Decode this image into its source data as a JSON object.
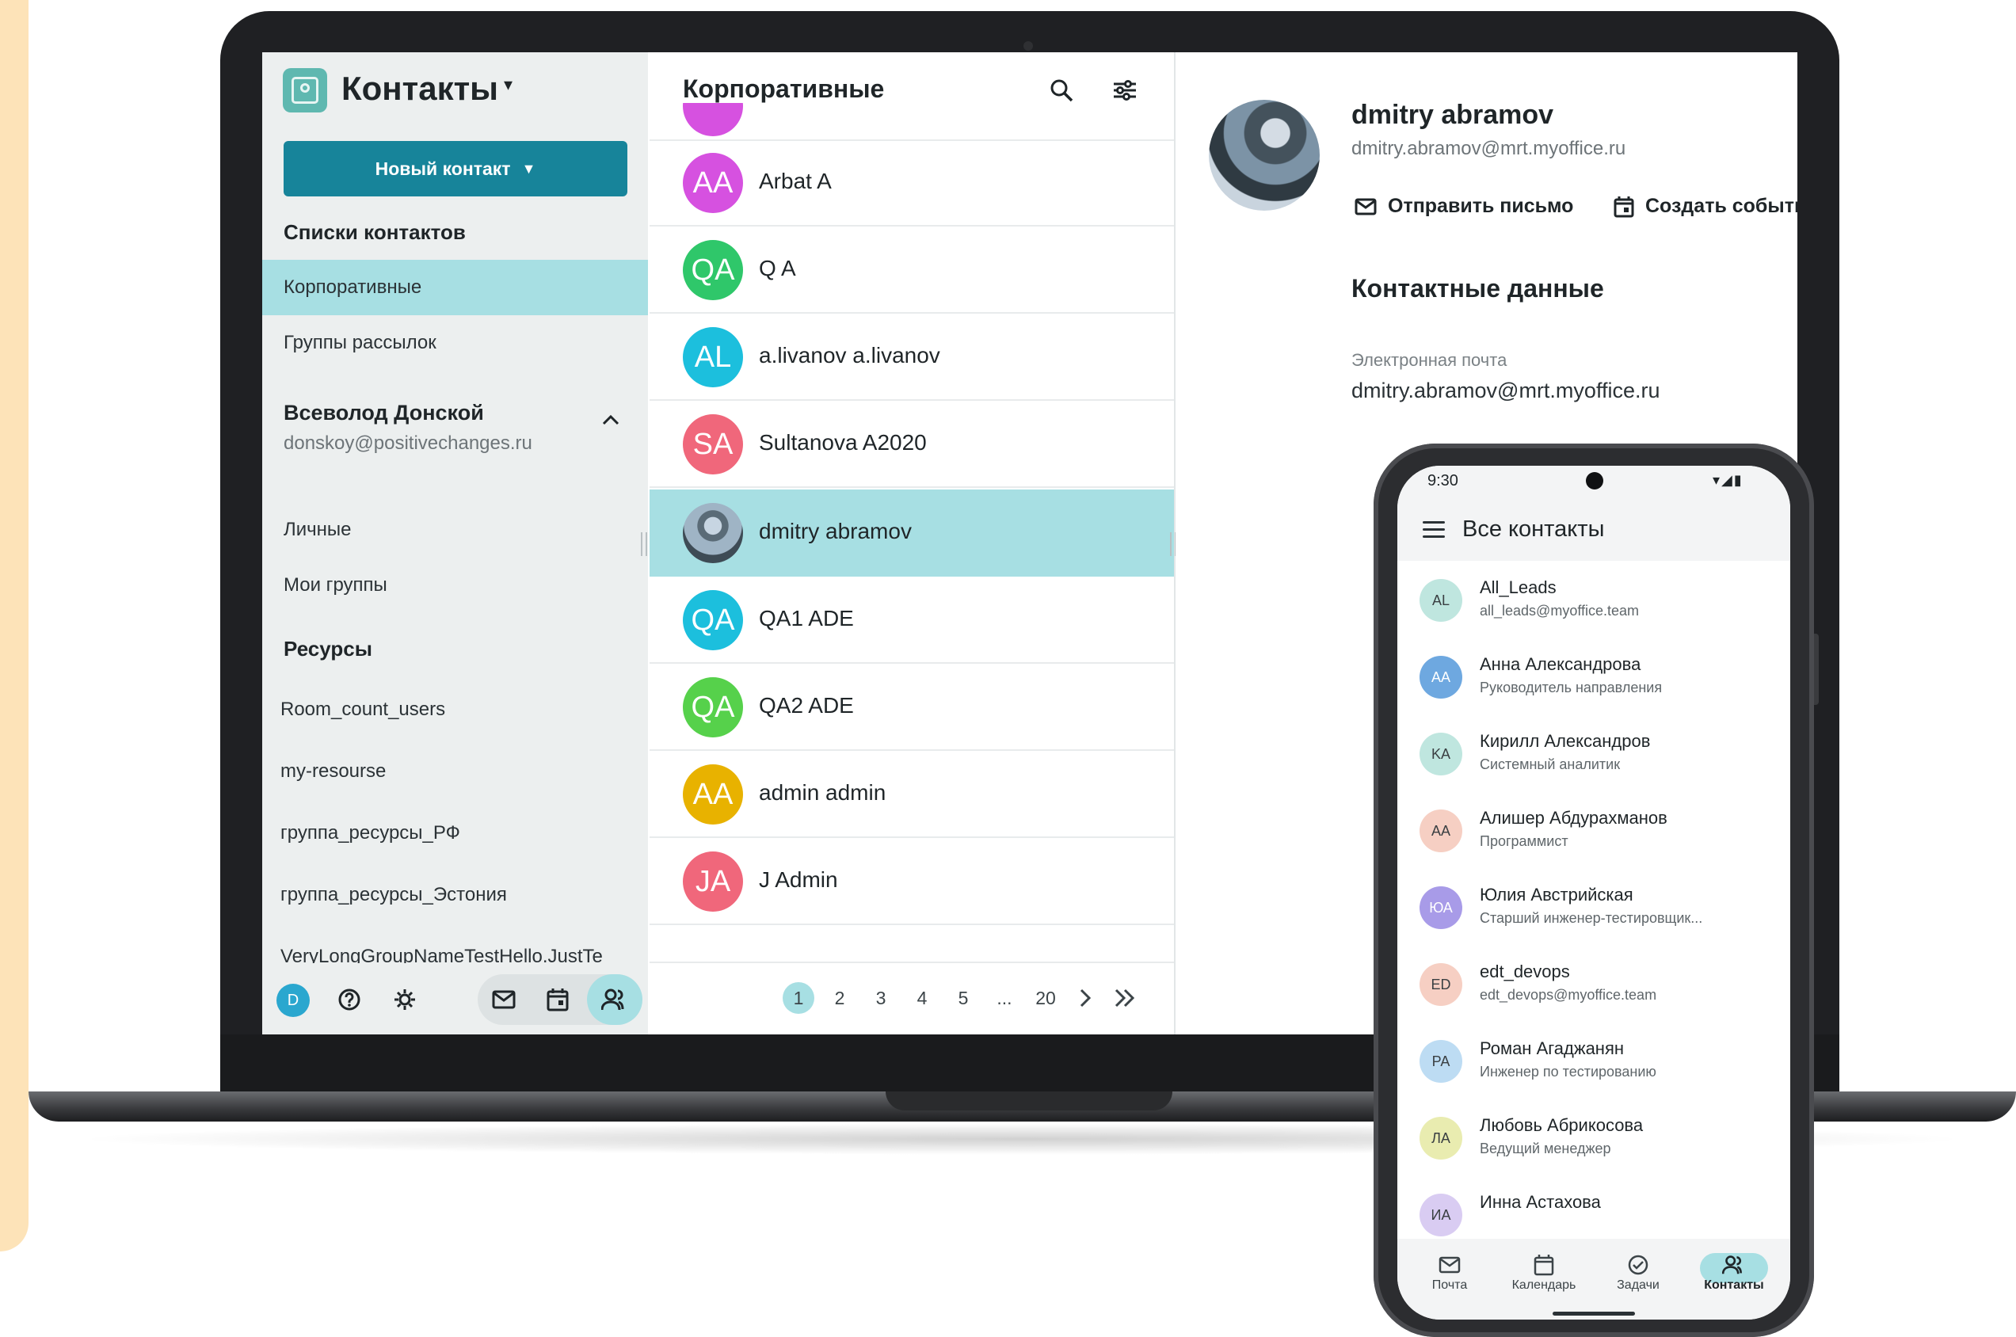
{
  "sidebar": {
    "app_title": "Контакты",
    "new_contact_button": "Новый контакт",
    "lists_heading": "Списки контактов",
    "lists": [
      {
        "label": "Корпоративные",
        "active": true
      },
      {
        "label": "Группы рассылок",
        "active": false
      }
    ],
    "account": {
      "name": "Всеволод Донской",
      "email": "donskoy@positivechanges.ru",
      "items": [
        "Личные",
        "Мои группы"
      ]
    },
    "resources_heading": "Ресурсы",
    "resources": [
      "Room_count_users",
      "my-resourse",
      "группа_ресурсы_РФ",
      "группа_ресурсы_Эстония",
      "VeryLongGroupNameTestHello.JustTe"
    ],
    "footer": {
      "avatar_letter": "D"
    }
  },
  "contact_list": {
    "title": "Корпоративные",
    "contacts": [
      {
        "initials": "AA",
        "name": "Arbat A",
        "color": "#d651e0"
      },
      {
        "initials": "QA",
        "name": "Q A",
        "color": "#2fc76a"
      },
      {
        "initials": "AL",
        "name": "a.livanov a.livanov",
        "color": "#1cbfdd"
      },
      {
        "initials": "SA",
        "name": "Sultanova A2020",
        "color": "#f0677b"
      },
      {
        "initials": "",
        "name": "dmitry abramov",
        "color": "photo",
        "selected": true
      },
      {
        "initials": "QA",
        "name": "QA1 ADE",
        "color": "#1cbfdd"
      },
      {
        "initials": "QA",
        "name": "QA2 ADE",
        "color": "#56d14b"
      },
      {
        "initials": "AA",
        "name": "admin admin",
        "color": "#e8b200"
      },
      {
        "initials": "JA",
        "name": "J Admin",
        "color": "#f0677b"
      }
    ],
    "pagination": {
      "pages": [
        "1",
        "2",
        "3",
        "4",
        "5",
        "...",
        "20"
      ],
      "current": "1"
    }
  },
  "detail": {
    "name": "dmitry abramov",
    "email": "dmitry.abramov@mrt.myoffice.ru",
    "send_email": "Отправить письмо",
    "create_event": "Создать событие",
    "section_title": "Контактные данные",
    "email_label": "Электронная почта",
    "email_value": "dmitry.abramov@mrt.myoffice.ru"
  },
  "phone": {
    "time": "9:30",
    "title": "Все контакты",
    "contacts": [
      {
        "initials": "AL",
        "name": "All_Leads",
        "sub": "all_leads@myoffice.team",
        "color": "#bfe6df"
      },
      {
        "initials": "AA",
        "name": "Анна Александрова",
        "sub": "Руководитель направления",
        "color": "#6ea8e0"
      },
      {
        "initials": "KA",
        "name": "Кирилл Александров",
        "sub": "Системный аналитик",
        "color": "#bfe6df"
      },
      {
        "initials": "AA",
        "name": "Алишер Абдурахманов",
        "sub": "Программист",
        "color": "#f6cfc3"
      },
      {
        "initials": "ЮА",
        "name": "Юлия Австрийская",
        "sub": "Старший инженер-тестировщик...",
        "color": "#a89be8"
      },
      {
        "initials": "ED",
        "name": "edt_devops",
        "sub": "edt_devops@myoffice.team",
        "color": "#f6cfc3"
      },
      {
        "initials": "PA",
        "name": "Роман Агаджанян",
        "sub": "Инженер по тестированию",
        "color": "#bddcf3"
      },
      {
        "initials": "ЛА",
        "name": "Любовь Абрикосова",
        "sub": "Ведущий менеджер",
        "color": "#e9ecb0"
      },
      {
        "initials": "ИА",
        "name": "Инна Астахова",
        "sub": "",
        "color": "#d9ccf2"
      }
    ],
    "nav": [
      "Почта",
      "Календарь",
      "Задачи",
      "Контакты"
    ]
  },
  "colors": {
    "accent": "#17849a",
    "selection": "#a7dfe3"
  }
}
